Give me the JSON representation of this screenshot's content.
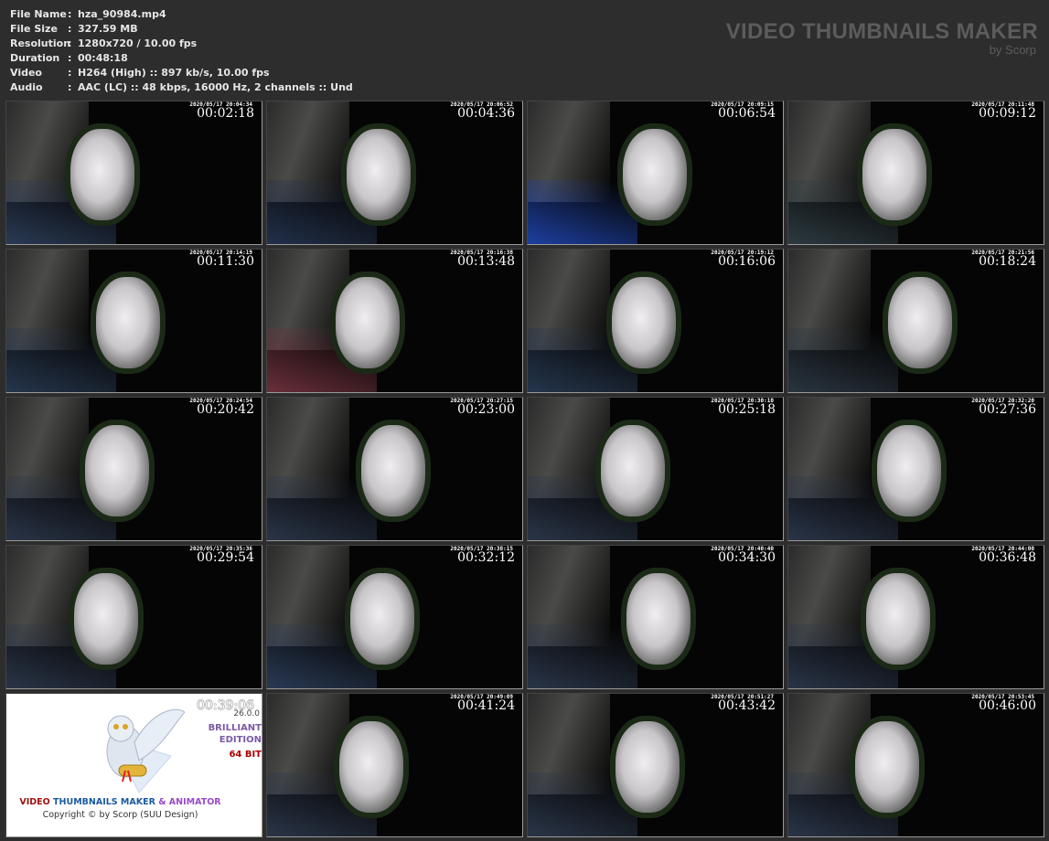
{
  "info": [
    {
      "key": "File Name",
      "value": "hza_90984.mp4"
    },
    {
      "key": "File Size",
      "value": "327.59 MB"
    },
    {
      "key": "Resolution",
      "value": "1280x720 / 10.00 fps"
    },
    {
      "key": "Duration",
      "value": "00:48:18"
    },
    {
      "key": "Video",
      "value": "H264 (High) :: 897 kb/s, 10.00 fps"
    },
    {
      "key": "Audio",
      "value": "AAC (LC) :: 48 kbps, 16000 Hz, 2 channels :: Und"
    }
  ],
  "separator": ":",
  "brand": {
    "title": "VIDEO THUMBNAILS MAKER",
    "subtitle": "by Scorp"
  },
  "thumbnails": [
    {
      "time": "00:02:18",
      "cam": "2020/05/17 20:04:34",
      "tint": "#2a3a55"
    },
    {
      "time": "00:04:36",
      "cam": "2020/05/17 20:06:52",
      "tint": "#22304a"
    },
    {
      "time": "00:06:54",
      "cam": "2020/05/17 20:09:15",
      "tint": "#1d3fa0"
    },
    {
      "time": "00:09:12",
      "cam": "2020/05/17 20:11:48",
      "tint": "#2d3a40"
    },
    {
      "time": "00:11:30",
      "cam": "2020/05/17 20:14:19",
      "tint": "#26364d"
    },
    {
      "time": "00:13:48",
      "cam": "2020/05/17 20:16:38",
      "tint": "#6a2f3a"
    },
    {
      "time": "00:16:06",
      "cam": "2020/05/17 20:19:12",
      "tint": "#26364d"
    },
    {
      "time": "00:18:24",
      "cam": "2020/05/17 20:21:56",
      "tint": "#2a3540"
    },
    {
      "time": "00:20:42",
      "cam": "2020/05/17 20:24:54",
      "tint": "#2a3548"
    },
    {
      "time": "00:23:00",
      "cam": "2020/05/17 20:27:15",
      "tint": "#2a3548"
    },
    {
      "time": "00:25:18",
      "cam": "2020/05/17 20:30:10",
      "tint": "#2a3548"
    },
    {
      "time": "00:27:36",
      "cam": "2020/05/17 20:32:20",
      "tint": "#2a3548"
    },
    {
      "time": "00:29:54",
      "cam": "2020/05/17 20:35:36",
      "tint": "#2a3548"
    },
    {
      "time": "00:32:12",
      "cam": "2020/05/17 20:38:15",
      "tint": "#2a3a55"
    },
    {
      "time": "00:34:30",
      "cam": "2020/05/17 20:40:40",
      "tint": "#2a3548"
    },
    {
      "time": "00:36:48",
      "cam": "2020/05/17 20:44:00",
      "tint": "#2a3548"
    },
    {
      "time": "00:39:06",
      "logo": true
    },
    {
      "time": "00:41:24",
      "cam": "2020/05/17 20:49:09",
      "tint": "#2a3548"
    },
    {
      "time": "00:43:42",
      "cam": "2020/05/17 20:51:27",
      "tint": "#2a3548"
    },
    {
      "time": "00:46:00",
      "cam": "2020/05/17 20:53:45",
      "tint": "#2a3548"
    }
  ],
  "logo": {
    "version": "26.0.0",
    "edition1": "BRILLIANT",
    "edition2": "EDITION",
    "bits": "64 BIT",
    "name_a": "VIDEO",
    "name_b": "THUMBNAILS MAKER",
    "name_c": "& ANIMATOR",
    "copyright": "Copyright © by Scorp (SUU Design)"
  }
}
